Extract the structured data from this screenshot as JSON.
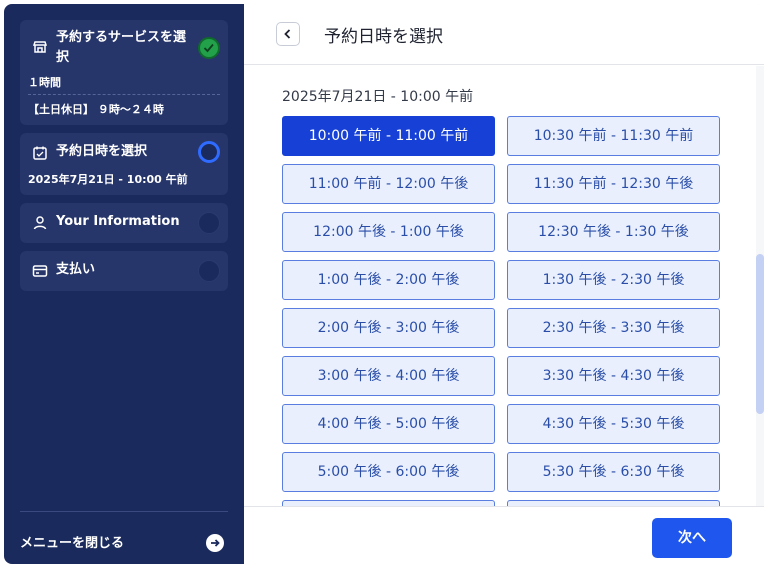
{
  "sidebar": {
    "steps": [
      {
        "title": "予約するサービスを選択",
        "status": "done",
        "icon": "store-icon",
        "details": [
          "１時間",
          "【土日休日】 ９時〜２４時"
        ]
      },
      {
        "title": "予約日時を選択",
        "status": "active",
        "icon": "calendar-icon",
        "details": [
          "2025年7月21日 - 10:00 午前"
        ]
      },
      {
        "title": "Your Information",
        "status": "pending",
        "icon": "person-icon"
      },
      {
        "title": "支払い",
        "status": "pending",
        "icon": "card-icon"
      }
    ],
    "close_menu_label": "メニューを閉じる"
  },
  "header": {
    "title": "予約日時を選択"
  },
  "content": {
    "selected_datetime": "2025年7月21日 - 10:00 午前",
    "slots": [
      "10:00 午前 - 11:00 午前",
      "10:30 午前 - 11:30 午前",
      "11:00 午前 - 12:00 午後",
      "11:30 午前 - 12:30 午後",
      "12:00 午後 - 1:00 午後",
      "12:30 午後 - 1:30 午後",
      "1:00 午後 - 2:00 午後",
      "1:30 午後 - 2:30 午後",
      "2:00 午後 - 3:00 午後",
      "2:30 午後 - 3:30 午後",
      "3:00 午後 - 4:00 午後",
      "3:30 午後 - 4:30 午後",
      "4:00 午後 - 5:00 午後",
      "4:30 午後 - 5:30 午後",
      "5:00 午後 - 6:00 午後",
      "5:30 午後 - 6:30 午後",
      "",
      ""
    ],
    "selected_slot": "10:00 午前 - 11:00 午前"
  },
  "footer": {
    "next_label": "次へ"
  },
  "colors": {
    "sidebar_bg": "#1b2a5c",
    "accent": "#1f57ee",
    "done": "#22a04a"
  }
}
